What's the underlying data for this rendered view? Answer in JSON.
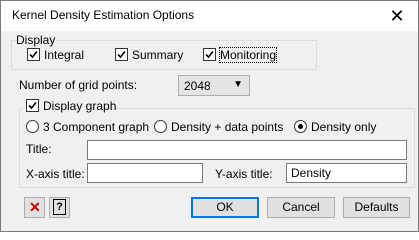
{
  "window": {
    "title": "Kernel Density Estimation Options",
    "close_glyph": "✕"
  },
  "display": {
    "label": "Display",
    "options": [
      {
        "label": "Integral",
        "checked": true
      },
      {
        "label": "Summary",
        "checked": true
      },
      {
        "label": "Monitoring",
        "checked": true
      }
    ]
  },
  "grid": {
    "label": "Number of grid points:",
    "value": "2048"
  },
  "graph": {
    "checkbox_label": "Display graph",
    "checked": true,
    "radios": [
      {
        "label": "3 Component graph",
        "selected": false
      },
      {
        "label": "Density + data points",
        "selected": false
      },
      {
        "label": "Density only",
        "selected": true
      }
    ],
    "title_label": "Title:",
    "title_value": "",
    "xaxis_label": "X-axis title:",
    "xaxis_value": "",
    "yaxis_label": "Y-axis title:",
    "yaxis_value": "Density"
  },
  "buttons": {
    "ok": "OK",
    "cancel": "Cancel",
    "defaults": "Defaults",
    "help_glyph": "?",
    "clear_glyph": "✕"
  },
  "colors": {
    "clear_icon": "#c00000",
    "default_border": "#0078d7"
  }
}
